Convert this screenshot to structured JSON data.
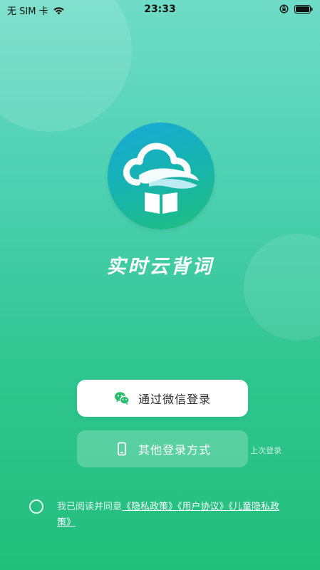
{
  "status_bar": {
    "carrier": "无 SIM 卡",
    "time": "23:33",
    "icons": [
      "wifi-icon",
      "rotation-lock-icon",
      "battery-icon"
    ]
  },
  "app": {
    "title": "实时云背词",
    "logo_icon": "cloud-book-logo"
  },
  "buttons": {
    "wechat_login": "通过微信登录",
    "other_login": "其他登录方式"
  },
  "last_login_badge": "上次登录",
  "agreement": {
    "prefix": "我已阅读并同意",
    "privacy_policy": "《隐私政策》",
    "user_agreement": "《用户协议》",
    "children_privacy": "《儿童隐私政策》"
  },
  "colors": {
    "gradient_top": "#6fdcc6",
    "gradient_bottom": "#22bf7c",
    "wechat_icon": "#2bbd6e",
    "logo_blue": "#18a9d8"
  }
}
